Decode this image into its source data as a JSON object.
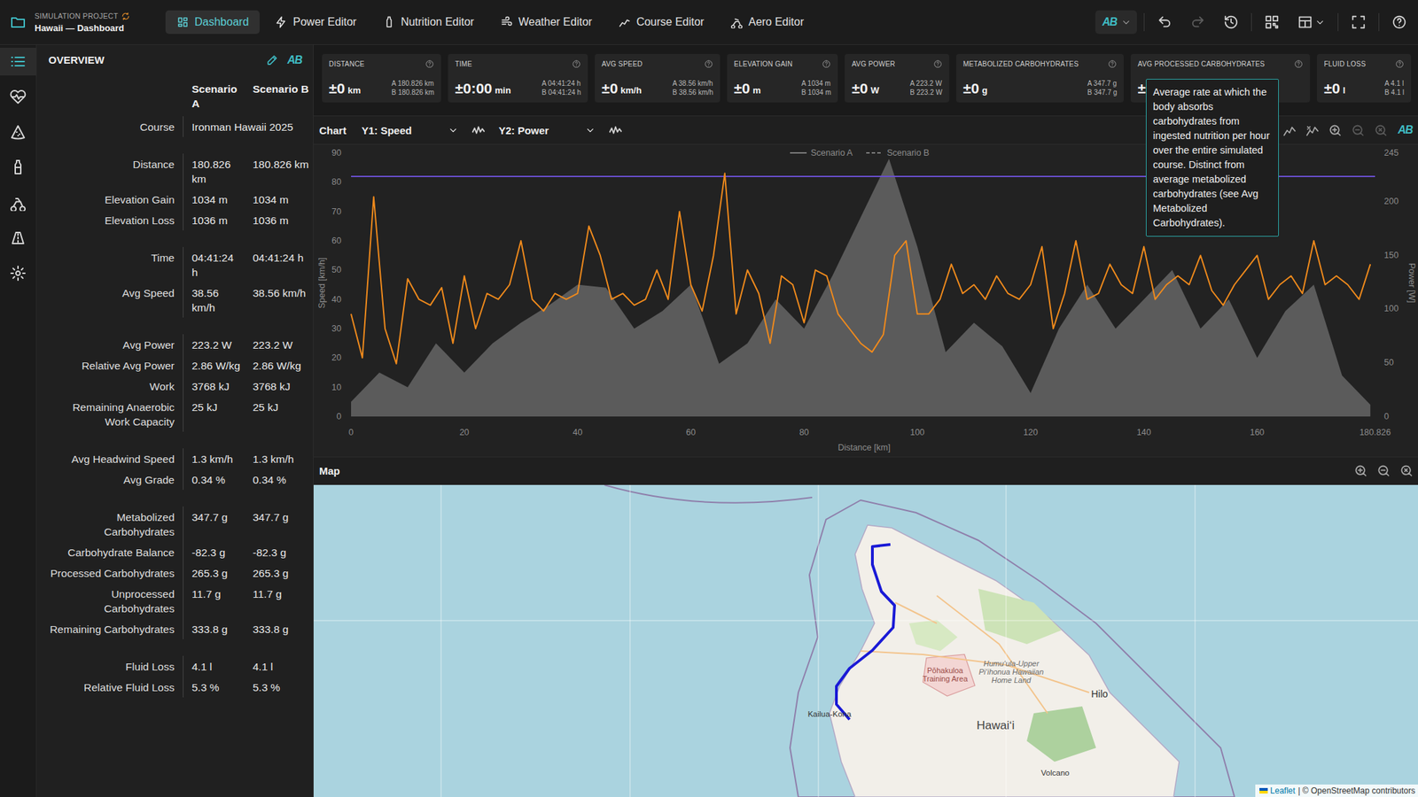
{
  "project": {
    "kicker": "SIMULATION PROJECT",
    "title": "Hawaii — Dashboard"
  },
  "tabs": [
    {
      "label": "Dashboard",
      "selected": true
    },
    {
      "label": "Power Editor",
      "selected": false
    },
    {
      "label": "Nutrition Editor",
      "selected": false
    },
    {
      "label": "Weather Editor",
      "selected": false
    },
    {
      "label": "Course Editor",
      "selected": false
    },
    {
      "label": "Aero Editor",
      "selected": false
    }
  ],
  "ab_icon": "AB",
  "history": {
    "undo_disabled": false,
    "redo_disabled": true
  },
  "rail": [
    {
      "selected": true
    },
    {
      "selected": false
    },
    {
      "selected": false
    },
    {
      "selected": false
    },
    {
      "selected": false
    },
    {
      "selected": false
    },
    {
      "selected": false
    }
  ],
  "overview": {
    "title": "OVERVIEW",
    "columns": [
      "Scenario A",
      "Scenario B"
    ],
    "groups": [
      [
        {
          "label": "Course",
          "kind": "span",
          "value": "Ironman Hawaii 2025"
        }
      ],
      [
        {
          "label": "Distance",
          "kind": "pair",
          "a": "180.826 km",
          "b": "180.826 km"
        },
        {
          "label": "Elevation Gain",
          "kind": "pair",
          "a": "1034 m",
          "b": "1034 m"
        },
        {
          "label": "Elevation Loss",
          "kind": "pair",
          "a": "1036 m",
          "b": "1036 m"
        }
      ],
      [
        {
          "label": "Time",
          "kind": "pair",
          "a": "04:41:24 h",
          "b": "04:41:24 h"
        },
        {
          "label": "Avg Speed",
          "kind": "pair",
          "a": "38.56 km/h",
          "b": "38.56 km/h"
        }
      ],
      [
        {
          "label": "Avg Power",
          "kind": "pair",
          "a": "223.2 W",
          "b": "223.2 W"
        },
        {
          "label": "Relative Avg Power",
          "kind": "pair",
          "a": "2.86 W/kg",
          "b": "2.86 W/kg"
        },
        {
          "label": "Work",
          "kind": "pair",
          "a": "3768 kJ",
          "b": "3768 kJ"
        },
        {
          "label": "Remaining Anaerobic Work Capacity",
          "kind": "pair",
          "a": "25 kJ",
          "b": "25 kJ"
        }
      ],
      [
        {
          "label": "Avg Headwind Speed",
          "kind": "pair",
          "a": "1.3 km/h",
          "b": "1.3 km/h"
        },
        {
          "label": "Avg Grade",
          "kind": "pair",
          "a": "0.34 %",
          "b": "0.34 %"
        }
      ],
      [
        {
          "label": "Metabolized Carbohydrates",
          "kind": "pair",
          "a": "347.7 g",
          "b": "347.7 g"
        },
        {
          "label": "Carbohydrate Balance",
          "kind": "pair",
          "a": "-82.3 g",
          "b": "-82.3 g"
        },
        {
          "label": "Processed Carbohydrates",
          "kind": "pair",
          "a": "265.3 g",
          "b": "265.3 g"
        },
        {
          "label": "Unprocessed Carbohydrates",
          "kind": "pair",
          "a": "11.7 g",
          "b": "11.7 g"
        },
        {
          "label": "Remaining Carbohydrates",
          "kind": "pair",
          "a": "333.8 g",
          "b": "333.8 g"
        }
      ],
      [
        {
          "label": "Fluid Loss",
          "kind": "pair",
          "a": "4.1 l",
          "b": "4.1 l"
        },
        {
          "label": "Relative Fluid Loss",
          "kind": "pair",
          "a": "5.3 %",
          "b": "5.3 %"
        }
      ]
    ]
  },
  "stats": [
    {
      "label": "DISTANCE",
      "value": "±0",
      "unit": "km",
      "a": "A 180.826 km",
      "b": "B 180.826 km",
      "tooltip": ""
    },
    {
      "label": "TIME",
      "value": "±0:00",
      "unit": "min",
      "a": "A 04:41:24 h",
      "b": "B 04:41:24 h",
      "tooltip": ""
    },
    {
      "label": "AVG SPEED",
      "value": "±0",
      "unit": "km/h",
      "a": "A 38.56 km/h",
      "b": "B 38.56 km/h",
      "tooltip": ""
    },
    {
      "label": "ELEVATION GAIN",
      "value": "±0",
      "unit": "m",
      "a": "A 1034 m",
      "b": "B 1034 m",
      "tooltip": ""
    },
    {
      "label": "AVG POWER",
      "value": "±0",
      "unit": "W",
      "a": "A 223.2 W",
      "b": "B 223.2 W",
      "tooltip": ""
    },
    {
      "label": "METABOLIZED CARBOHYDRATES",
      "value": "±0",
      "unit": "g",
      "a": "A 347.7 g",
      "b": "B 347.7 g",
      "tooltip": ""
    },
    {
      "label": "AVG PROCESSED CARBOHYDRATES",
      "value": "±",
      "unit": "",
      "a": "",
      "b": "",
      "tooltip": "Average rate at which the body absorbs carbohydrates from ingested nutrition per hour over the entire simulated course. Distinct from average metabolized carbohydrates (see Avg Metabolized Carbohydrates)."
    },
    {
      "label": "FLUID LOSS",
      "value": "±0",
      "unit": "l",
      "a": "A 4.1 l",
      "b": "B 4.1 l",
      "tooltip": ""
    }
  ],
  "chart": {
    "title": "Chart",
    "y1": "Y1: Speed",
    "y2": "Y2: Power",
    "tools": [
      {
        "selected": true,
        "disabled": false
      },
      {
        "selected": false,
        "disabled": false
      },
      {
        "selected": false,
        "disabled": false
      },
      {
        "selected": false,
        "disabled": false
      },
      {
        "selected": false,
        "disabled": false
      },
      {
        "selected": false,
        "disabled": true
      },
      {
        "selected": false,
        "disabled": true
      }
    ],
    "legend": [
      {
        "label": "Scenario A",
        "kind": "solid"
      },
      {
        "label": "Scenario B",
        "kind": "dashed"
      }
    ],
    "y1_axis": "Speed [km/h]",
    "y2_axis": "Power [W]",
    "x_axis": "Distance [km]",
    "y1_ticks": [
      "0",
      "10",
      "20",
      "30",
      "40",
      "50",
      "60",
      "70",
      "80",
      "90"
    ],
    "y2_ticks": [
      "0",
      "50",
      "100",
      "150",
      "200",
      "245"
    ],
    "x_ticks": [
      "0",
      "20",
      "40",
      "60",
      "80",
      "100",
      "120",
      "140",
      "160",
      "180.826"
    ],
    "speed": {
      "color": "#f08a1c",
      "x": [
        0,
        2,
        4,
        6,
        8,
        10,
        12,
        14,
        16,
        18,
        20,
        22,
        24,
        26,
        28,
        30,
        32,
        34,
        36,
        38,
        40,
        42,
        44,
        46,
        48,
        50,
        52,
        54,
        56,
        58,
        60,
        62,
        64,
        66,
        68,
        70,
        72,
        74,
        76,
        78,
        80,
        82,
        84,
        86,
        88,
        90,
        92,
        94,
        96,
        98,
        100,
        102,
        104,
        106,
        108,
        110,
        112,
        114,
        116,
        118,
        120,
        122,
        124,
        126,
        128,
        130,
        132,
        134,
        136,
        138,
        140,
        142,
        144,
        146,
        148,
        150,
        152,
        154,
        156,
        158,
        160,
        162,
        164,
        166,
        168,
        170,
        172,
        174,
        176,
        178,
        180
      ],
      "values": [
        35,
        20,
        75,
        30,
        18,
        47,
        40,
        38,
        44,
        25,
        48,
        30,
        42,
        40,
        45,
        60,
        40,
        36,
        42,
        40,
        42,
        65,
        55,
        40,
        42,
        38,
        40,
        50,
        40,
        70,
        45,
        36,
        55,
        83,
        35,
        50,
        42,
        25,
        48,
        45,
        32,
        50,
        48,
        35,
        30,
        25,
        22,
        28,
        55,
        60,
        35,
        35,
        40,
        52,
        42,
        45,
        40,
        48,
        42,
        40,
        45,
        58,
        30,
        42,
        60,
        40,
        42,
        52,
        45,
        42,
        58,
        40,
        45,
        48,
        45,
        55,
        43,
        38,
        45,
        50,
        55,
        40,
        45,
        48,
        42,
        60,
        45,
        48,
        45,
        40,
        52
      ]
    },
    "profile": {
      "color": "#5b5b5b",
      "x": [
        0,
        5,
        10,
        15,
        20,
        25,
        30,
        35,
        40,
        45,
        50,
        55,
        60,
        65,
        70,
        75,
        80,
        85,
        90,
        95,
        100,
        105,
        110,
        115,
        120,
        125,
        130,
        135,
        140,
        145,
        150,
        155,
        160,
        165,
        170,
        175,
        180
      ],
      "values": [
        5,
        15,
        10,
        25,
        15,
        25,
        32,
        38,
        45,
        44,
        30,
        36,
        45,
        18,
        25,
        40,
        30,
        48,
        68,
        88,
        58,
        22,
        32,
        24,
        8,
        30,
        45,
        30,
        40,
        50,
        30,
        40,
        20,
        36,
        45,
        14,
        4
      ]
    },
    "reference": {
      "value": 223.2,
      "color": "#6a4fd0"
    }
  },
  "map": {
    "title": "Map",
    "labels": [
      {
        "text": "Kailua-Kona",
        "kind": "town"
      },
      {
        "text": "Pōhakuloa Training Area",
        "kind": "military"
      },
      {
        "text": "Humuʻula-Upper Piʻihonua Hawaiian Home Land",
        "kind": "reserve"
      },
      {
        "text": "Hilo",
        "kind": "city"
      },
      {
        "text": "Hawaiʻi",
        "kind": "island"
      },
      {
        "text": "Volcano",
        "kind": "town"
      }
    ],
    "attribution_link": "Leaflet",
    "attribution": "| © OpenStreetMap contributors"
  }
}
